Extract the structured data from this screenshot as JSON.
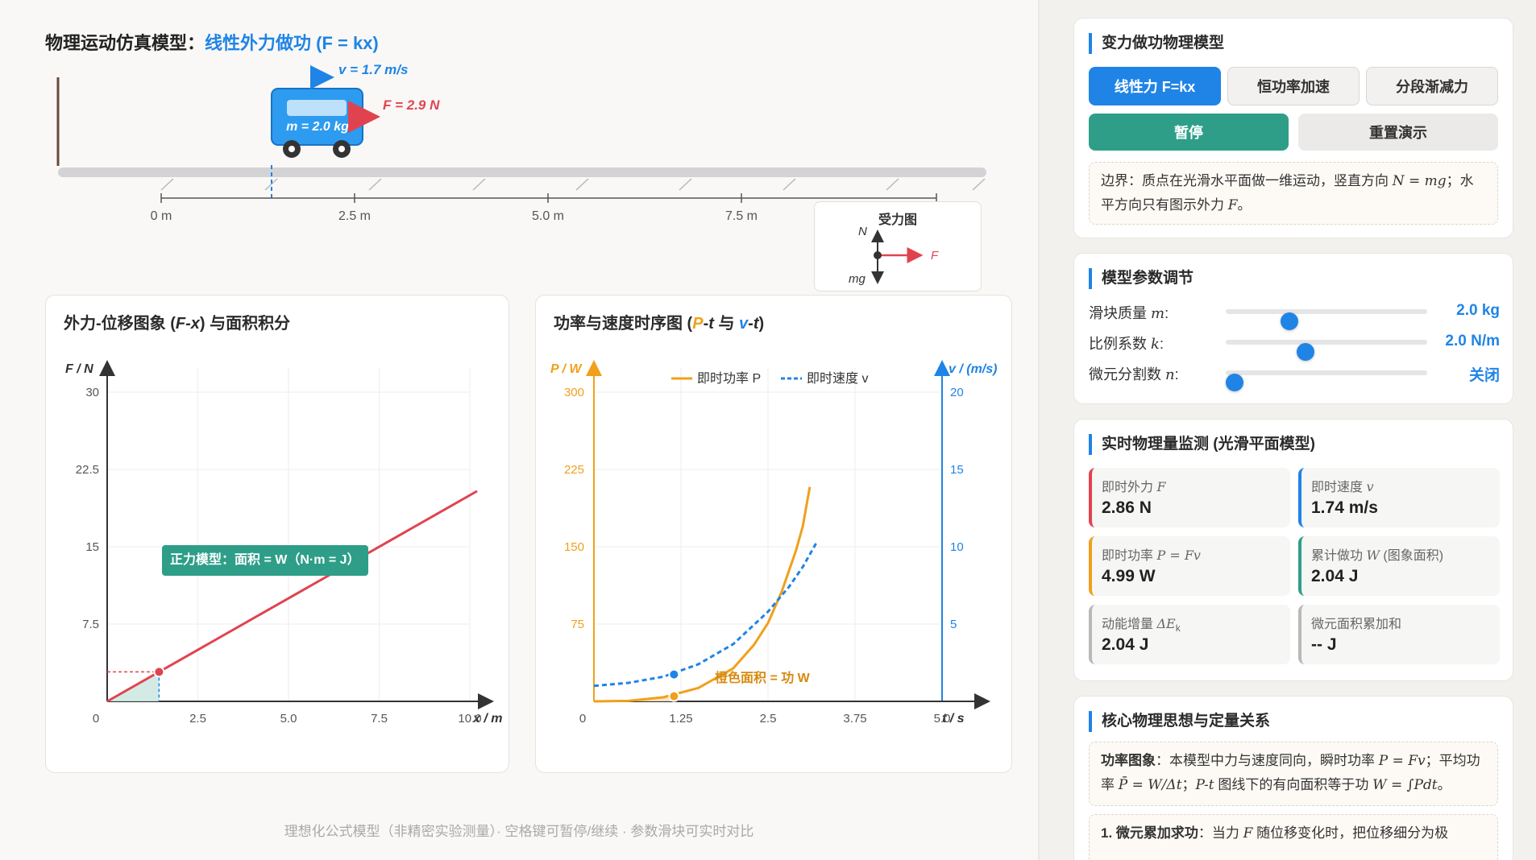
{
  "sim": {
    "title_prefix": "物理运动仿真模型：",
    "title_model": "线性外力做功 (F = kx)",
    "velocity_label": "v = 1.7 m/s",
    "force_label": "F = 2.9 N",
    "mass_label": "m = 2.0 kg",
    "ruler_ticks": [
      "0 m",
      "2.5 m",
      "5.0 m",
      "7.5 m"
    ],
    "force_diagram": {
      "title": "受力图",
      "n": "N",
      "f": "F",
      "mg": "mg"
    }
  },
  "fx_chart": {
    "title_prefix": "外力-位移图象 (",
    "title_sym": "F-x",
    "title_suffix": ") 与面积积分",
    "annotation": "正力模型：面积 = W（N·m = J）"
  },
  "pt_chart": {
    "title_prefix": "功率与速度时序图 (",
    "title_p": "P",
    "title_mid1": "-",
    "title_t1": "t",
    "title_and": " 与 ",
    "title_v": "v",
    "title_t2": "t",
    "title_suffix": ")",
    "legend_power": "即时功率 P",
    "legend_velocity": "即时速度 v",
    "area_note": "橙色面积 = 功 W"
  },
  "chart_data": [
    {
      "type": "line",
      "title": "外力-位移图象 (F-x) 与面积积分",
      "xlabel": "x / m",
      "ylabel": "F / N",
      "xlim": [
        0,
        10
      ],
      "ylim": [
        0,
        30
      ],
      "x_ticks": [
        "0",
        "2.5",
        "5.0",
        "7.5",
        "10.0"
      ],
      "y_ticks": [
        "0",
        "7.5",
        "15",
        "22.5",
        "30"
      ],
      "series": [
        {
          "x": [
            0,
            10.2
          ],
          "y": [
            0,
            20.4
          ]
        }
      ],
      "current_point": {
        "x": 1.43,
        "y": 2.86
      },
      "grid": true
    },
    {
      "type": "line",
      "title": "功率与速度时序图 (P-t 与 v-t)",
      "xlabel": "t / s",
      "ylabel_left": "P / W",
      "ylabel_right": "v / (m/s)",
      "xlim": [
        0,
        5
      ],
      "ylim_left": [
        0,
        300
      ],
      "ylim_right": [
        0,
        20
      ],
      "x_ticks": [
        "0",
        "1.25",
        "2.5",
        "3.75",
        "5.0"
      ],
      "y_ticks_left": [
        "75",
        "150",
        "225",
        "300"
      ],
      "y_ticks_right": [
        "5",
        "10",
        "15",
        "20"
      ],
      "series": [
        {
          "name": "即时功率 P",
          "axis": "left",
          "x": [
            0,
            0.5,
            1.0,
            1.5,
            2.0,
            2.3,
            2.5,
            2.7,
            2.9,
            3.0,
            3.1
          ],
          "y": [
            0,
            0.5,
            4,
            13,
            32,
            55,
            76,
            107,
            146,
            170,
            208
          ]
        },
        {
          "name": "即时速度 v",
          "axis": "right",
          "x": [
            0,
            0.5,
            1.0,
            1.5,
            2.0,
            2.5,
            2.8,
            3.0,
            3.2
          ],
          "y": [
            1,
            1.2,
            1.6,
            2.4,
            3.7,
            5.8,
            7.4,
            8.7,
            10.3
          ]
        }
      ],
      "current_point": {
        "t": 1.15,
        "P": 4.99,
        "v": 1.74
      },
      "legend": "top-center",
      "grid": true
    }
  ],
  "footer": "理想化公式模型（非精密实验测量）· 空格键可暂停/继续 · 参数滑块可实时对比",
  "panel_model": {
    "title": "变力做功物理模型",
    "tabs": [
      "线性力 F=kx",
      "恒功率加速",
      "分段渐减力"
    ],
    "pause_label": "暂停",
    "reset_label": "重置演示",
    "note_prefix": "边界：质点在光滑水平面做一维运动，竖直方向 ",
    "note_eq": "N = mg",
    "note_mid": "；水平方向只有图示外力 ",
    "note_f": "F",
    "note_end": "。"
  },
  "panel_params": {
    "title": "模型参数调节",
    "rows": [
      {
        "label": "滑块质量",
        "sym": "m",
        "value": "2.0 kg",
        "level": 0.27
      },
      {
        "label": "比例系数",
        "sym": "k",
        "value": "2.0 N/m",
        "level": 0.35
      },
      {
        "label": "微元分割数",
        "sym": "n",
        "value": "关闭",
        "level": 0.0
      }
    ]
  },
  "panel_monitor": {
    "title": "实时物理量监测 (光滑平面模型)",
    "metrics": [
      {
        "label": "即时外力",
        "sym": "F",
        "value": "2.86 N",
        "color": "#e0434f"
      },
      {
        "label": "即时速度",
        "sym": "v",
        "value": "1.74 m/s",
        "color": "#1f84e6"
      },
      {
        "label": "即时功率",
        "sym": "P = Fv",
        "value": "4.99 W",
        "color": "#f0a01c"
      },
      {
        "label": "累计做功",
        "sym": "W",
        "suffix": " (图象面积)",
        "value": "2.04 J",
        "color": "#2e9e88"
      },
      {
        "label": "动能增量",
        "sym": "ΔE",
        "sub": "k",
        "value": "2.04 J",
        "color": "#b9b9b9"
      },
      {
        "label": "微元面积累加和",
        "sym": "",
        "value": "-- J",
        "color": "#b9b9b9"
      }
    ]
  },
  "panel_core": {
    "title": "核心物理思想与定量关系",
    "note1_bold": "功率图象",
    "note1_a": "：本模型中力与速度同向，瞬时功率 ",
    "note1_eq1": "P = Fv",
    "note1_b": "；平均功率 ",
    "note1_eq2": "P̄ = W/Δt",
    "note1_c": "；",
    "note1_pt": "P-t",
    "note1_d": " 图线下的有向面积等于功 ",
    "note1_eq3": "W = ∫Pdt",
    "note1_e": "。",
    "note2_bold": "1. 微元累加求功",
    "note2_a": "：当力 ",
    "note2_f": "F",
    "note2_b": " 随位移变化时，把位移细分为极"
  }
}
